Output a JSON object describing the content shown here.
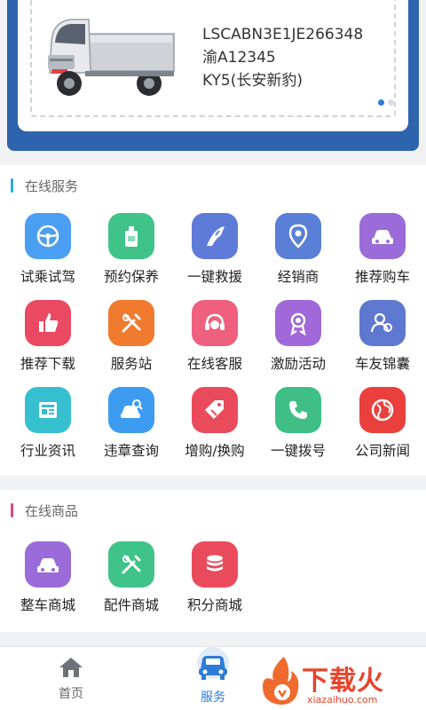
{
  "vehicle": {
    "vin": "LSCABN3E1JE266348",
    "plate": "渝A12345",
    "model": "KY5(长安新豹)"
  },
  "services": {
    "title": "在线服务",
    "accent": "#2aa9e0",
    "items": [
      {
        "label": "试乘试驾",
        "icon": "steering-wheel-icon",
        "color": "#4b9ff2"
      },
      {
        "label": "预约保养",
        "icon": "oil-bottle-icon",
        "color": "#3fc389"
      },
      {
        "label": "一键救援",
        "icon": "road-icon",
        "color": "#5f7bd8"
      },
      {
        "label": "经销商",
        "icon": "location-pin-icon",
        "color": "#5a7fd6"
      },
      {
        "label": "推荐购车",
        "icon": "car-icon",
        "color": "#9a6bd9"
      },
      {
        "label": "推荐下载",
        "icon": "thumbs-up-icon",
        "color": "#ea4a61"
      },
      {
        "label": "服务站",
        "icon": "tools-icon",
        "color": "#f07a2e"
      },
      {
        "label": "在线客服",
        "icon": "headset-icon",
        "color": "#ef5f7e"
      },
      {
        "label": "激励活动",
        "icon": "medal-icon",
        "color": "#a068d8"
      },
      {
        "label": "车友锦囊",
        "icon": "people-icon",
        "color": "#5f78cf"
      },
      {
        "label": "行业资讯",
        "icon": "news-icon",
        "color": "#36bfcf"
      },
      {
        "label": "违章查询",
        "icon": "car-search-icon",
        "color": "#3d9cf0"
      },
      {
        "label": "增购/换购",
        "icon": "tag-icon",
        "color": "#ea4b5c"
      },
      {
        "label": "一键拨号",
        "icon": "phone-icon",
        "color": "#3fbf86"
      },
      {
        "label": "公司新闻",
        "icon": "globe-icon",
        "color": "#e9403d"
      }
    ]
  },
  "goods": {
    "title": "在线商品",
    "accent": "#e0457b",
    "items": [
      {
        "label": "整车商城",
        "icon": "car-icon",
        "color": "#9a6bd9"
      },
      {
        "label": "配件商城",
        "icon": "tools-icon",
        "color": "#3fc389"
      },
      {
        "label": "积分商城",
        "icon": "coins-icon",
        "color": "#ea4b5c"
      }
    ]
  },
  "tabbar": {
    "home_label": "首页",
    "service_label": "服务"
  },
  "watermark": {
    "text": "下载火",
    "sub": "xiazaihuo.com"
  }
}
